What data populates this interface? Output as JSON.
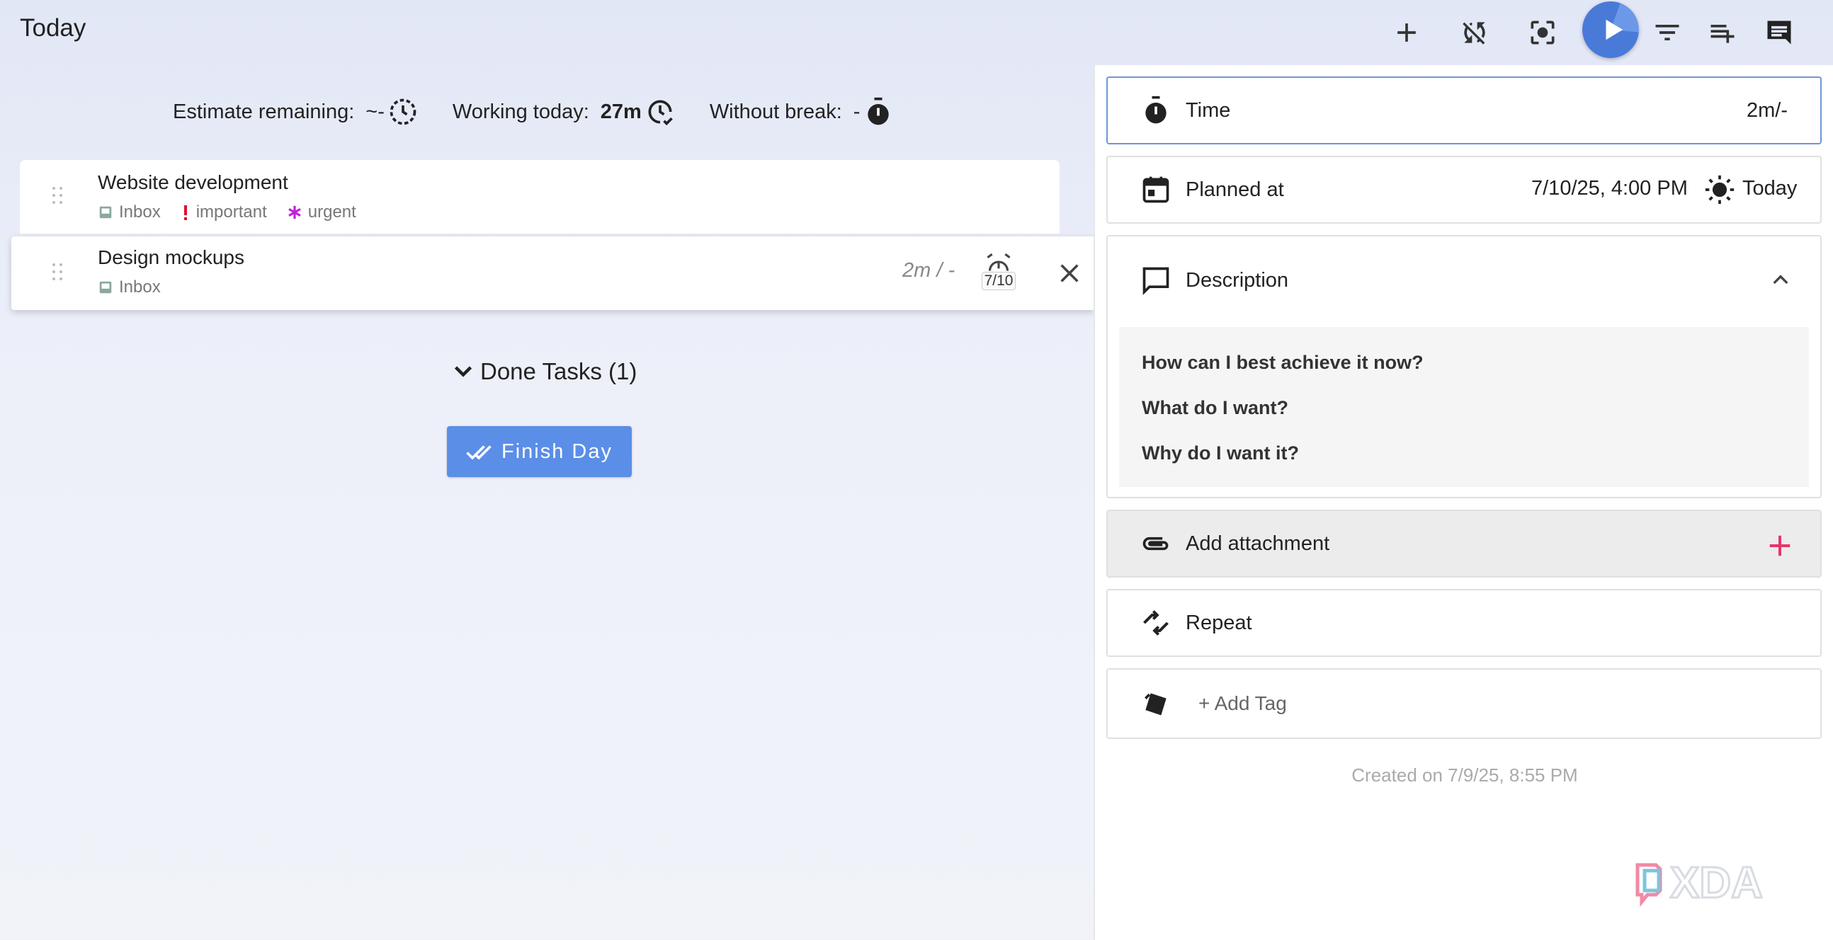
{
  "page": {
    "title": "Today"
  },
  "toolbar": {
    "icons": [
      "add-icon",
      "sync-off-icon",
      "focus-icon",
      "play-icon",
      "filter-icon",
      "add-list-icon",
      "comment-icon"
    ]
  },
  "stats": {
    "estimate_label": "Estimate remaining:",
    "estimate_value": "~-",
    "working_label": "Working today:",
    "working_value": "27m",
    "break_label": "Without break:",
    "break_value": "-"
  },
  "tasks": [
    {
      "title": "Website development",
      "tags": [
        {
          "label": "Inbox",
          "icon": "inbox-icon",
          "color": "#8aa8a0"
        },
        {
          "label": "important",
          "icon": "exclamation-icon",
          "color": "#e0102f"
        },
        {
          "label": "urgent",
          "icon": "asterisk-icon",
          "color": "#c21fd8"
        }
      ]
    },
    {
      "title": "Design mockups",
      "tags": [
        {
          "label": "Inbox",
          "icon": "inbox-icon",
          "color": "#8aa8a0"
        }
      ],
      "time_estimate": "2m / -",
      "reminder_date": "7/10"
    }
  ],
  "done_tasks": {
    "label": "Done Tasks (1)"
  },
  "finish_day": {
    "label": "Finish Day"
  },
  "panel": {
    "time": {
      "label": "Time",
      "value": "2m/-"
    },
    "planned": {
      "label": "Planned at",
      "value": "7/10/25, 4:00 PM",
      "day": "Today"
    },
    "description": {
      "label": "Description",
      "lines": [
        "How can I best achieve it now?",
        "What do I want?",
        "Why do I want it?"
      ]
    },
    "attachment": {
      "label": "Add attachment"
    },
    "repeat": {
      "label": "Repeat"
    },
    "tags": {
      "label": "+ Add Tag"
    },
    "created": "Created on 7/9/25, 8:55 PM"
  },
  "watermark": "XDA",
  "colors": {
    "accent": "#5b8ee6",
    "play": "#4a7ad8",
    "add_attachment": "#e8336b"
  }
}
